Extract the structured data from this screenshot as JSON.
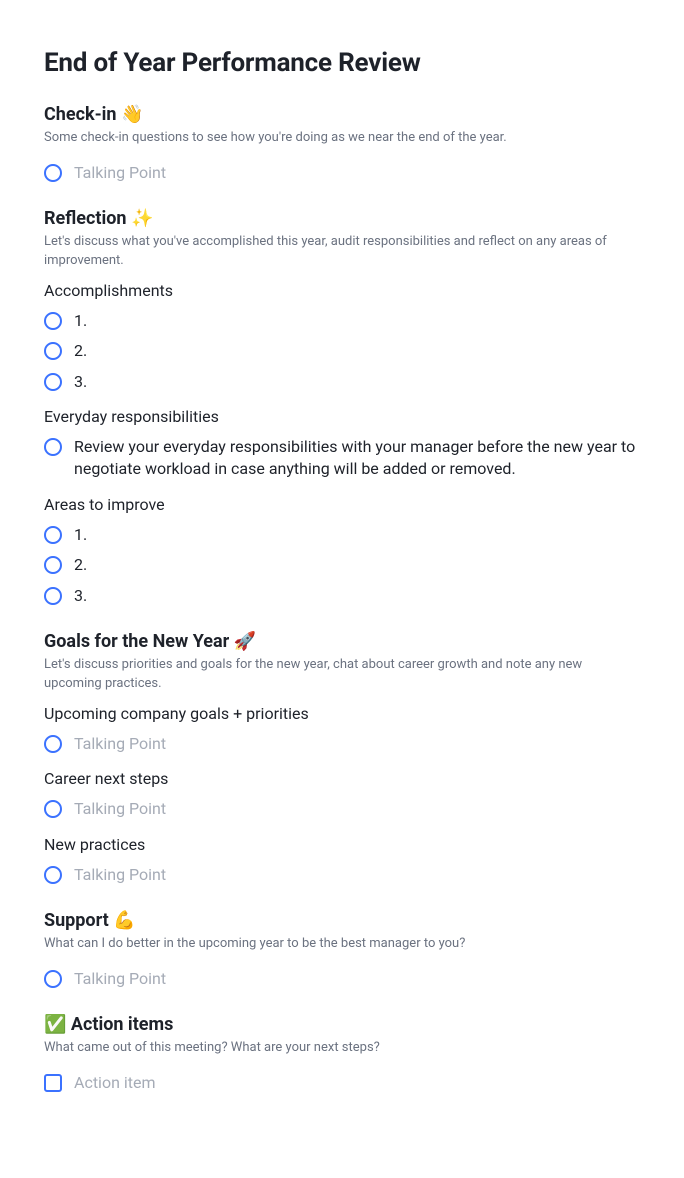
{
  "title": "End of Year Performance Review",
  "sections": {
    "checkin": {
      "heading": "Check-in 👋",
      "desc": "Some check-in questions to see how you're doing as we near the end of the year.",
      "item_placeholder": "Talking Point"
    },
    "reflection": {
      "heading": "Reflection ✨",
      "desc": "Let's discuss what you've accomplished this year, audit responsibilities and reflect on any areas of improvement.",
      "accomplishments": {
        "label": "Accomplishments",
        "items": [
          "1.",
          "2.",
          "3."
        ]
      },
      "responsibilities": {
        "label": "Everyday responsibilities",
        "item": "Review your everyday responsibilities with your manager before the new year to negotiate workload in case anything will be added or removed."
      },
      "areas": {
        "label": "Areas to improve",
        "items": [
          "1.",
          "2.",
          "3."
        ]
      }
    },
    "goals": {
      "heading": "Goals for the New Year 🚀",
      "desc": "Let's discuss priorities and goals for the new year, chat about career growth and note any new upcoming practices.",
      "upcoming": {
        "label": "Upcoming company goals + priorities",
        "placeholder": "Talking Point"
      },
      "career": {
        "label": "Career next steps",
        "placeholder": "Talking Point"
      },
      "practices": {
        "label": "New practices",
        "placeholder": "Talking Point"
      }
    },
    "support": {
      "heading": "Support 💪",
      "desc": "What can I do better in the upcoming year to be the best manager to you?",
      "placeholder": "Talking Point"
    },
    "action": {
      "heading": "✅ Action items",
      "desc": "What came out of this meeting? What are your next steps?",
      "placeholder": "Action item"
    }
  }
}
